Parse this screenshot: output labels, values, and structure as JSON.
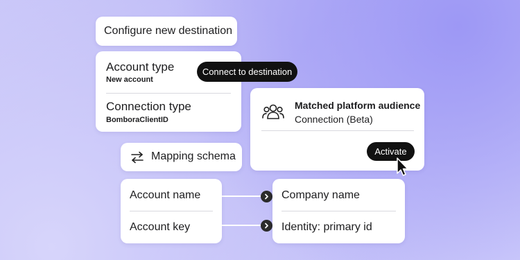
{
  "configure_card": {
    "title": "Configure new destination"
  },
  "account_card": {
    "account_type_label": "Account type",
    "account_type_value": "New account",
    "connection_type_label": "Connection type",
    "connection_type_value": "BomboraClientID"
  },
  "connect_pill": {
    "label": "Connect to destination"
  },
  "audience_card": {
    "title": "Matched platform audience",
    "subtitle": "Connection (Beta)",
    "activate_label": "Activate",
    "icon": "users-icon"
  },
  "mapping_card": {
    "label": "Mapping schema",
    "icon": "swap-arrows-icon"
  },
  "mapping_source": {
    "rows": [
      "Account name",
      "Account key"
    ]
  },
  "mapping_target": {
    "rows": [
      "Company name",
      "Identity: primary id"
    ]
  },
  "colors": {
    "pill_bg": "#111111",
    "card_bg": "#ffffff"
  }
}
